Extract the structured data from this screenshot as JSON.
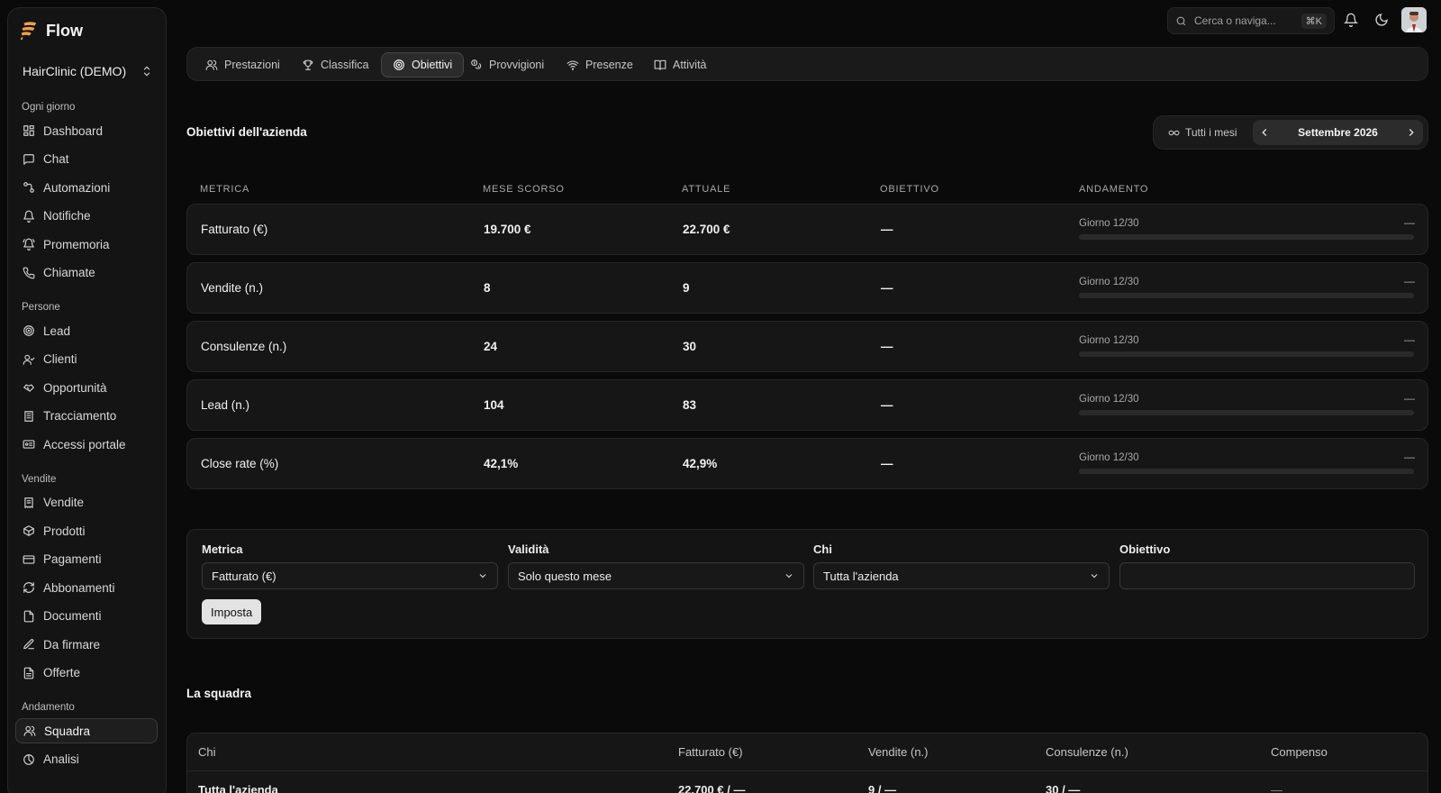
{
  "brand": {
    "name": "Flow"
  },
  "org": {
    "name": "HairClinic (DEMO)"
  },
  "sidebar": {
    "sections": [
      {
        "label": "Ogni giorno",
        "items": [
          "Dashboard",
          "Chat",
          "Automazioni",
          "Notifiche",
          "Promemoria",
          "Chiamate"
        ]
      },
      {
        "label": "Persone",
        "items": [
          "Lead",
          "Clienti",
          "Opportunità",
          "Tracciamento",
          "Accessi portale"
        ]
      },
      {
        "label": "Vendite",
        "items": [
          "Vendite",
          "Prodotti",
          "Pagamenti",
          "Abbonamenti",
          "Documenti",
          "Da firmare",
          "Offerte"
        ]
      },
      {
        "label": "Andamento",
        "items": [
          "Squadra",
          "Analisi"
        ]
      }
    ],
    "active_item": "Squadra"
  },
  "search": {
    "placeholder": "Cerca o naviga...",
    "shortcut": "⌘K"
  },
  "tabs": [
    {
      "label": "Prestazioni",
      "icon": "users-icon"
    },
    {
      "label": "Classifica",
      "icon": "trophy-icon"
    },
    {
      "label": "Obiettivi",
      "icon": "target-icon",
      "active": true
    },
    {
      "label": "Provvigioni",
      "icon": "coins-icon"
    },
    {
      "label": "Presenze",
      "icon": "wifi-icon"
    },
    {
      "label": "Attività",
      "icon": "book-icon"
    }
  ],
  "goals": {
    "title": "Obiettivi dell'azienda",
    "all_months": "Tutti i mesi",
    "month": "Settembre 2026",
    "columns": [
      "METRICA",
      "MESE SCORSO",
      "ATTUALE",
      "OBIETTIVO",
      "ANDAMENTO"
    ],
    "rows": [
      {
        "metric": "Fatturato (€)",
        "last": "19.700 €",
        "current": "22.700 €",
        "target": "—",
        "progress_label": "Giorno 12/30",
        "progress_value": "—",
        "progress": 0
      },
      {
        "metric": "Vendite (n.)",
        "last": "8",
        "current": "9",
        "target": "—",
        "progress_label": "Giorno 12/30",
        "progress_value": "—",
        "progress": 0
      },
      {
        "metric": "Consulenze (n.)",
        "last": "24",
        "current": "30",
        "target": "—",
        "progress_label": "Giorno 12/30",
        "progress_value": "—",
        "progress": 0
      },
      {
        "metric": "Lead (n.)",
        "last": "104",
        "current": "83",
        "target": "—",
        "progress_label": "Giorno 12/30",
        "progress_value": "—",
        "progress": 0
      },
      {
        "metric": "Close rate (%)",
        "last": "42,1%",
        "current": "42,9%",
        "target": "—",
        "progress_label": "Giorno 12/30",
        "progress_value": "—",
        "progress": 0
      }
    ]
  },
  "form": {
    "metric_label": "Metrica",
    "metric_value": "Fatturato (€)",
    "validity_label": "Validità",
    "validity_value": "Solo questo mese",
    "who_label": "Chi",
    "who_value": "Tutta l'azienda",
    "target_label": "Obiettivo",
    "target_value": "",
    "submit": "Imposta"
  },
  "team": {
    "title": "La squadra",
    "columns": [
      "Chi",
      "Fatturato (€)",
      "Vendite (n.)",
      "Consulenze (n.)",
      "Compenso"
    ],
    "rows": [
      {
        "who": "Tutta l'azienda",
        "revenue": "22.700 € / —",
        "sales": "9 / —",
        "consults": "30 / —",
        "pay": "—"
      }
    ]
  },
  "colors": {
    "background": "#0a0a0a",
    "surface": "#161616",
    "border": "#262626",
    "brand_orange": "#f0a04b"
  }
}
